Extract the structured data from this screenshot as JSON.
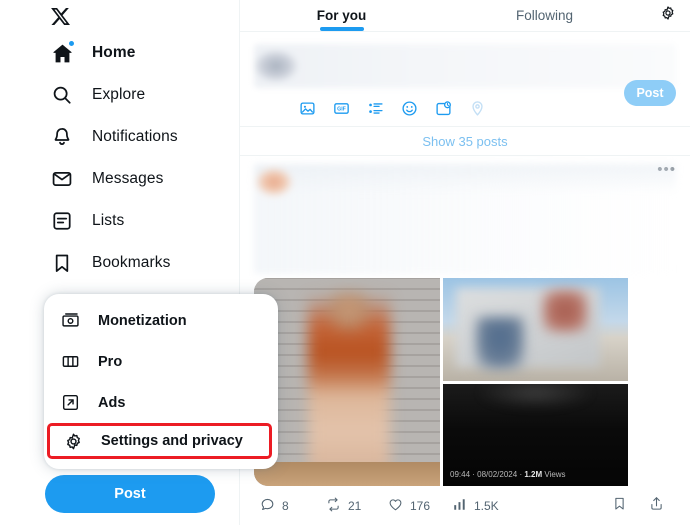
{
  "sidebar": {
    "logo_name": "x-logo",
    "items": [
      {
        "label": "Home",
        "icon": "home-icon",
        "active": true,
        "badge": true
      },
      {
        "label": "Explore",
        "icon": "search-icon",
        "active": false,
        "badge": false
      },
      {
        "label": "Notifications",
        "icon": "bell-icon",
        "active": false,
        "badge": false
      },
      {
        "label": "Messages",
        "icon": "envelope-icon",
        "active": false,
        "badge": false
      },
      {
        "label": "Lists",
        "icon": "list-icon",
        "active": false,
        "badge": false
      },
      {
        "label": "Bookmarks",
        "icon": "bookmark-icon",
        "active": false,
        "badge": false
      }
    ],
    "post_button": "Post"
  },
  "dropdown": {
    "items": [
      {
        "label": "Monetization",
        "icon": "monetization-icon",
        "highlighted": false
      },
      {
        "label": "Pro",
        "icon": "pro-columns-icon",
        "highlighted": false
      },
      {
        "label": "Ads",
        "icon": "ads-arrow-icon",
        "highlighted": false
      },
      {
        "label": "Settings and privacy",
        "icon": "gear-icon",
        "highlighted": true
      }
    ],
    "highlight_color": "#ec1c24"
  },
  "main": {
    "tabs": [
      {
        "label": "For you",
        "active": true
      },
      {
        "label": "Following",
        "active": false
      }
    ],
    "settings_icon": "gear-icon",
    "compose": {
      "post_label": "Post",
      "tools": [
        "image-icon",
        "gif-icon",
        "poll-icon",
        "emoji-icon",
        "schedule-icon",
        "location-icon"
      ]
    },
    "show_posts_label": "Show 35 posts",
    "post": {
      "more_icon": "more-options-icon",
      "media": [
        {
          "name": "photo-person-brick-wall"
        },
        {
          "name": "photo-outdoor-sign"
        },
        {
          "name": "video-dark-screenshot"
        }
      ],
      "video_meta": {
        "time": "09:44",
        "date": "08/02/2024",
        "views_count": "1.2M",
        "views_label": "Views"
      },
      "engagement": [
        {
          "icon": "reply-icon",
          "count": "8"
        },
        {
          "icon": "repost-icon",
          "count": "21"
        },
        {
          "icon": "like-icon",
          "count": "176"
        },
        {
          "icon": "views-icon",
          "count": "1.5K"
        }
      ],
      "actions": [
        {
          "icon": "bookmark-icon"
        },
        {
          "icon": "share-icon"
        }
      ]
    }
  },
  "colors": {
    "accent": "#1d9bf0",
    "text": "#0f1419",
    "muted": "#536471",
    "highlight": "#ec1c24"
  }
}
